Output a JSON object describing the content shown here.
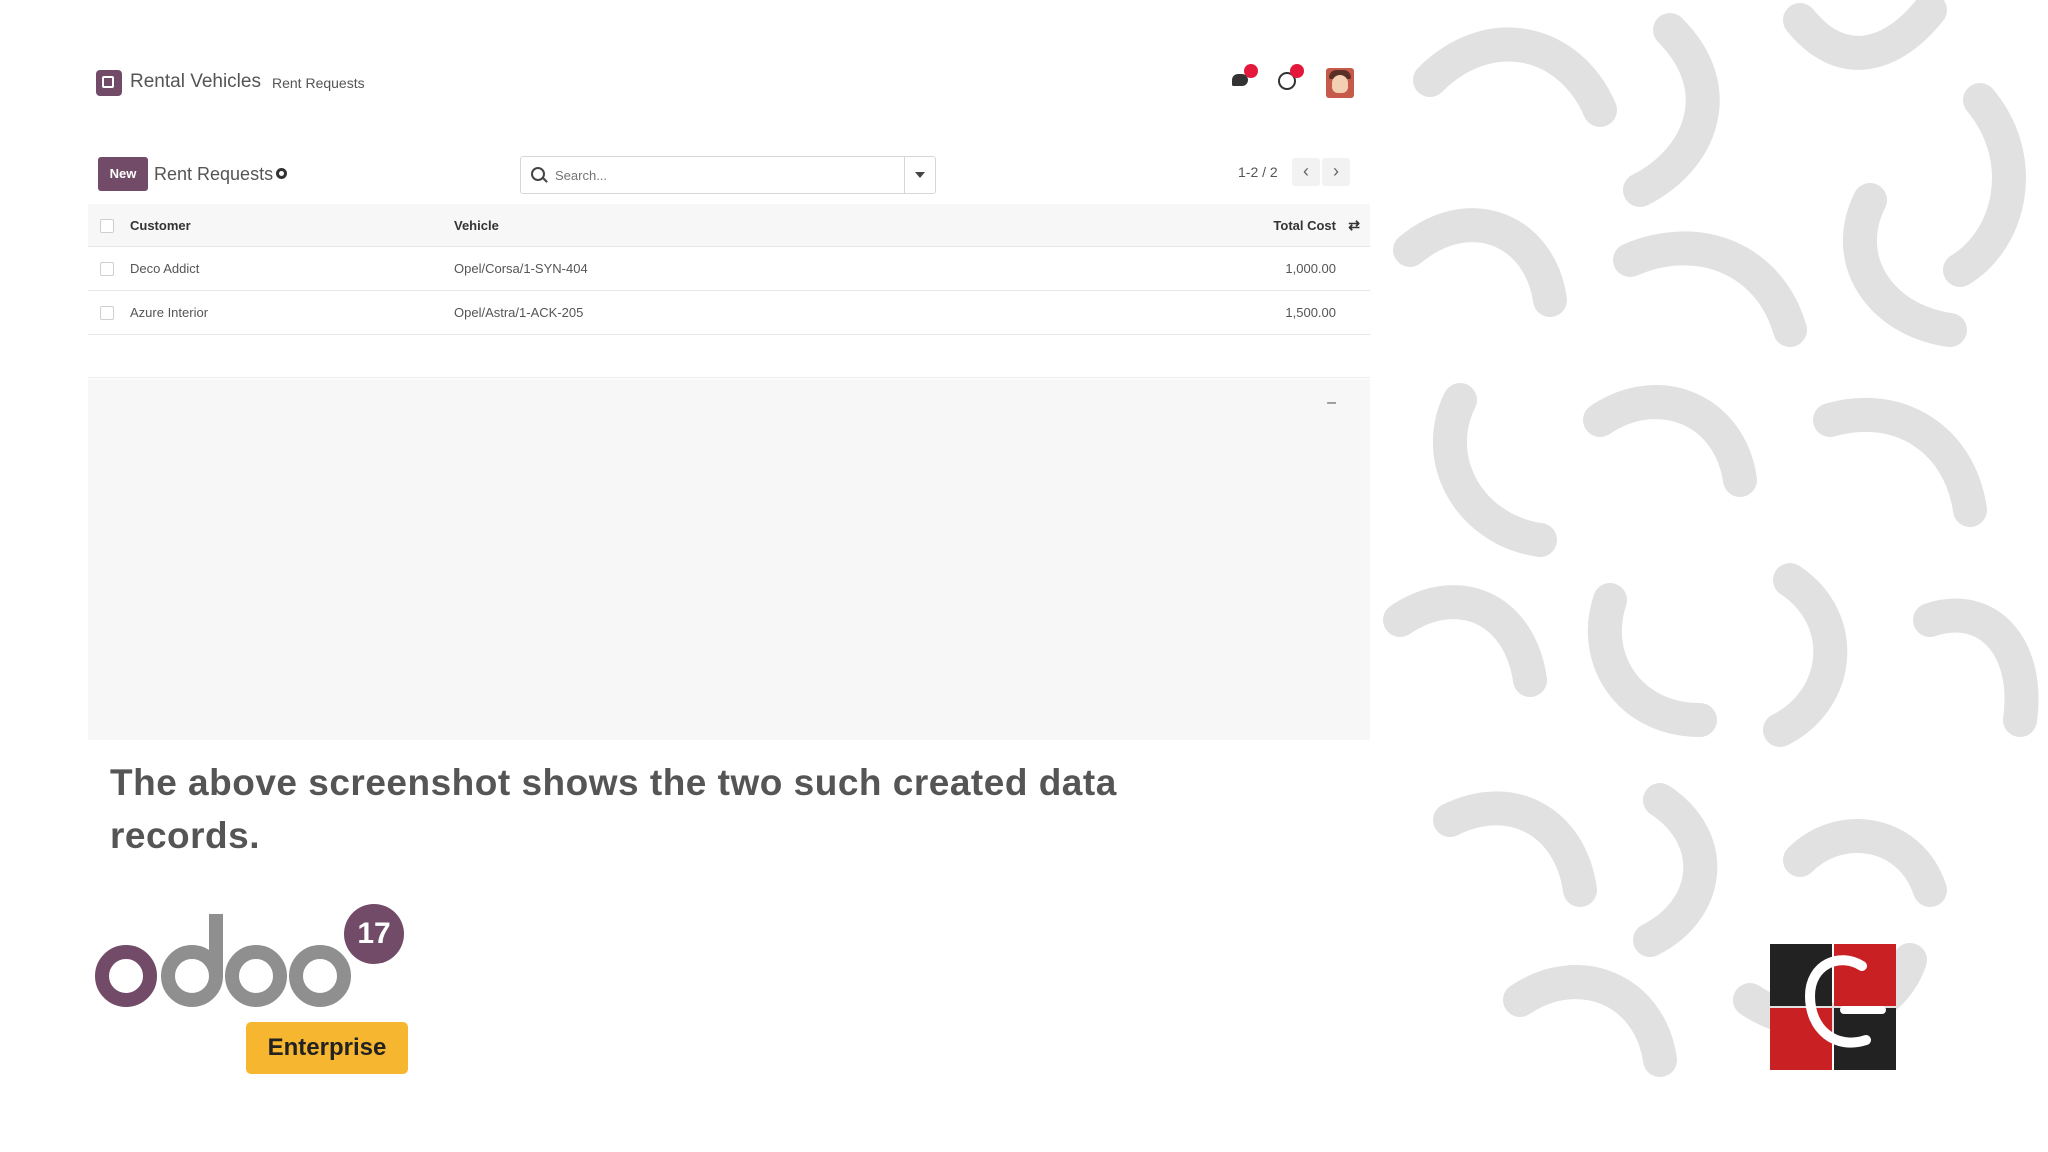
{
  "topbar": {
    "app_name": "Rental Vehicles",
    "menu_item": "Rent Requests",
    "chat_icon": "chat-bubble-icon",
    "activity_icon": "clock-icon"
  },
  "control_panel": {
    "new_label": "New",
    "title": "Rent Requests",
    "search_placeholder": "Search...",
    "pager": "1-2 / 2",
    "prev_symbol": "‹",
    "next_symbol": "›"
  },
  "list": {
    "columns": {
      "customer": "Customer",
      "vehicle": "Vehicle",
      "total_cost": "Total Cost"
    },
    "rows": [
      {
        "customer": "Deco Addict",
        "vehicle": "Opel/Corsa/1-SYN-404",
        "total_cost": "1,000.00"
      },
      {
        "customer": "Azure Interior",
        "vehicle": "Opel/Astra/1-ACK-205",
        "total_cost": "1,500.00"
      }
    ],
    "footer_total": "–"
  },
  "caption": "The above screenshot shows the two such created data records.",
  "logo": {
    "version": "17",
    "edition": "Enterprise",
    "brand_color": "#714B67",
    "edition_color": "#F6B62F"
  },
  "colors": {
    "accent": "#714B67",
    "notification": "#E4183B"
  }
}
